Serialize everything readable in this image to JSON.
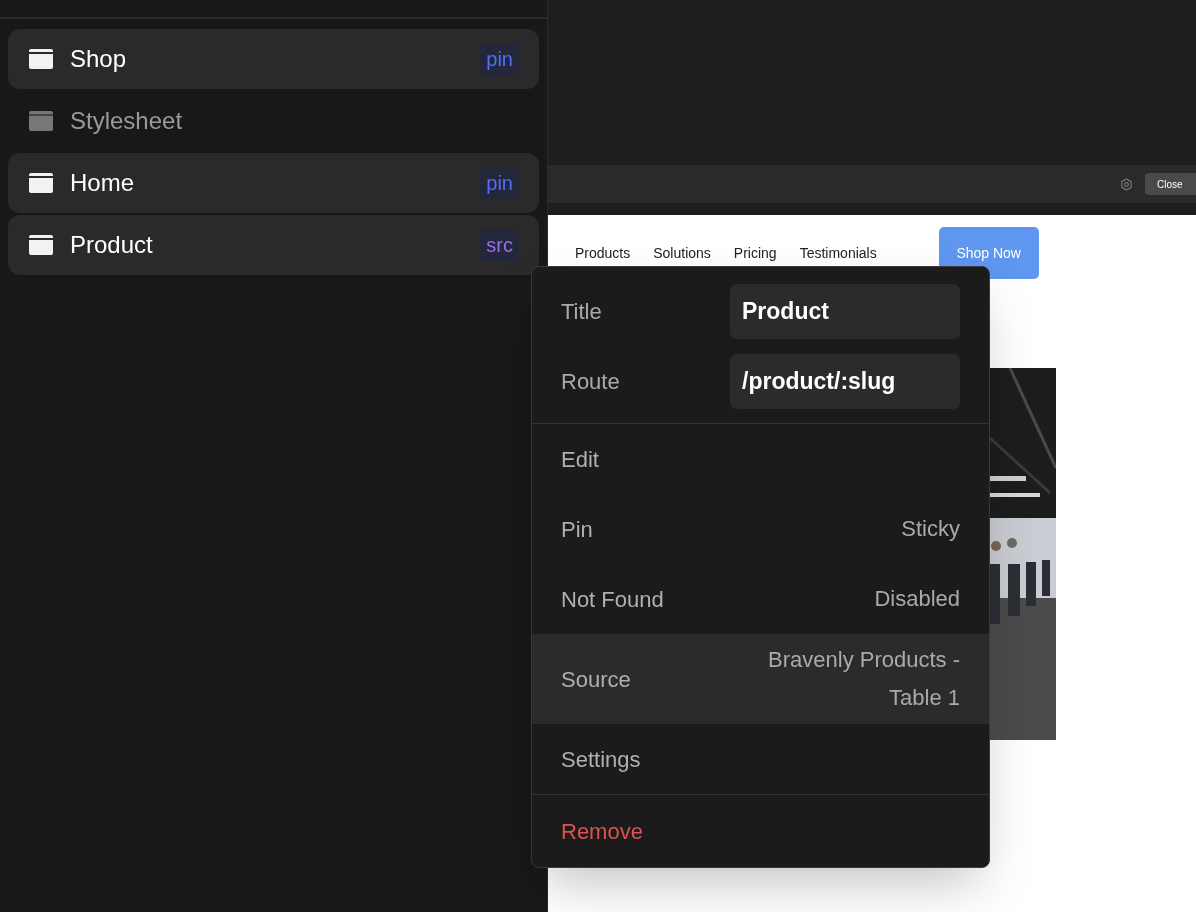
{
  "pages": [
    {
      "label": "Shop",
      "active": true,
      "badge": {
        "text": "pin",
        "color": "#4f6ef7"
      }
    },
    {
      "label": "Stylesheet",
      "active": false
    },
    {
      "label": "Home",
      "active": true,
      "badge": {
        "text": "pin",
        "color": "#4f6ef7"
      }
    },
    {
      "label": "Product",
      "active": true,
      "badge": {
        "text": "src",
        "color": "#9b6cf2"
      }
    }
  ],
  "toolbar": {
    "button": "Close"
  },
  "preview": {
    "nav": [
      "Products",
      "Solutions",
      "Pricing",
      "Testimonials"
    ],
    "cta": "Shop Now",
    "image": {
      "kind": "picture"
    }
  },
  "context_menu": {
    "sections": [
      [
        {
          "kind": "field",
          "label": "Title",
          "value": "Product"
        },
        {
          "kind": "field",
          "label": "Route",
          "value": "/product/:slug"
        }
      ],
      [
        {
          "kind": "item",
          "label": "Edit",
          "highlighted": false
        },
        {
          "kind": "item",
          "label": "Pin",
          "value": "Sticky",
          "highlighted": false
        },
        {
          "kind": "item",
          "label": "Not Found",
          "value": "Disabled",
          "highlighted": false
        },
        {
          "kind": "item",
          "label": "Source",
          "value": "Bravenly Products - Table 1",
          "highlighted": true
        },
        {
          "kind": "item",
          "label": "Settings",
          "highlighted": false
        }
      ],
      [
        {
          "kind": "danger",
          "label": "Remove",
          "highlighted": false
        }
      ]
    ]
  }
}
